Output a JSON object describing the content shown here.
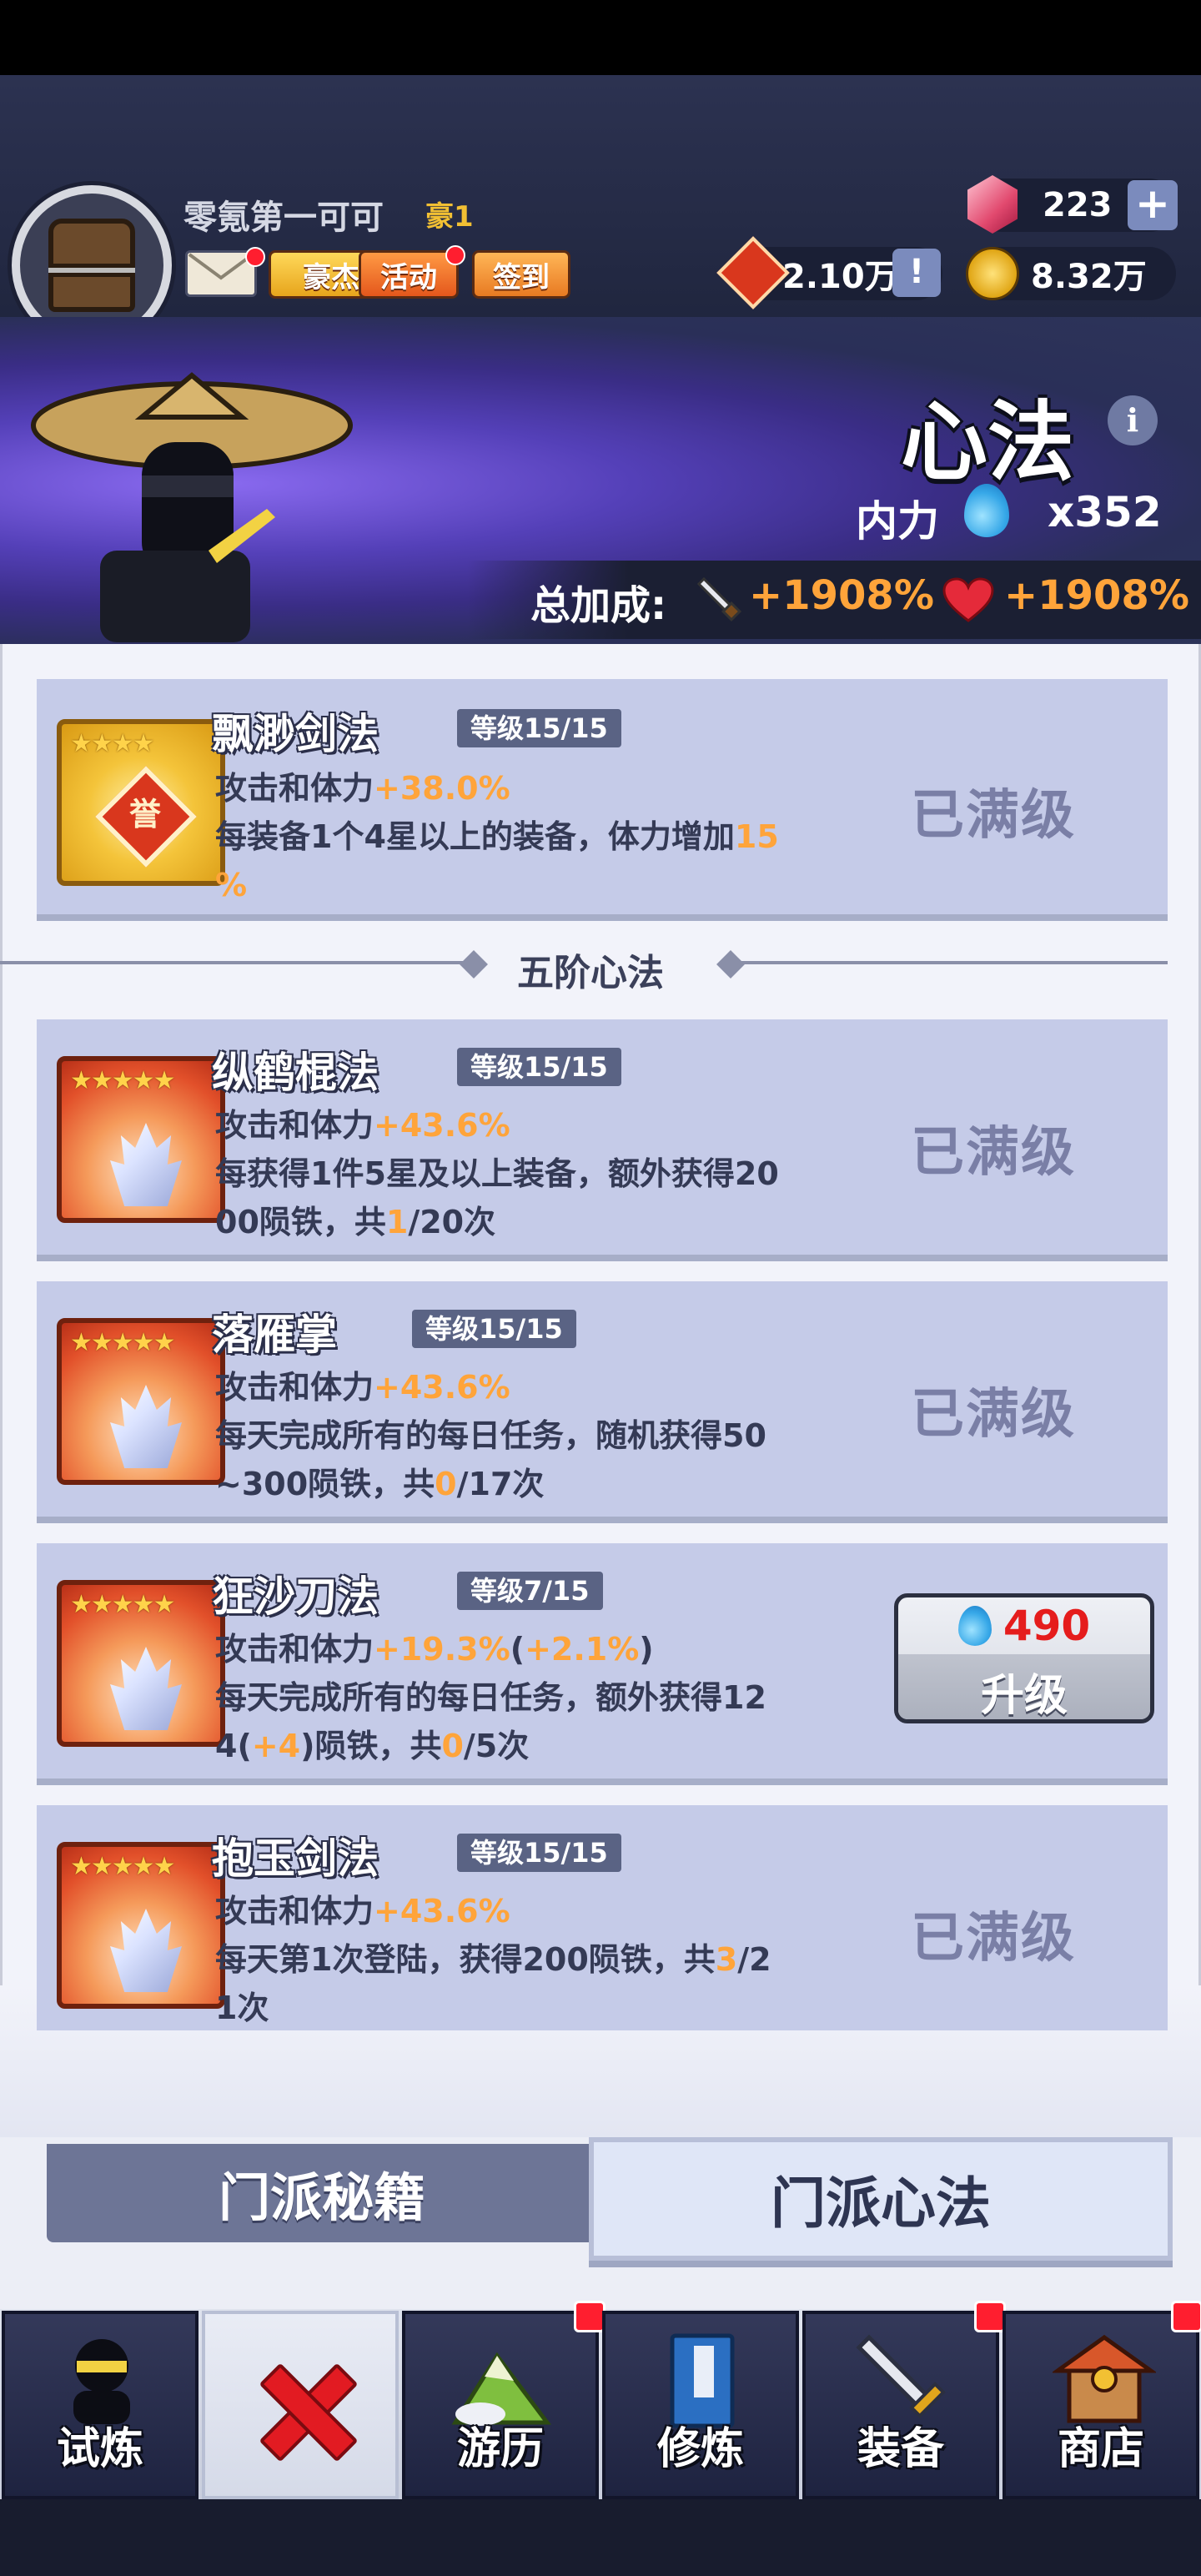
{
  "player": {
    "name": "零氪第一可可",
    "vip": "豪1",
    "gems": "223",
    "honor": "2.10万",
    "coins": "8.32万"
  },
  "header_buttons": {
    "hero": "豪杰",
    "activity": "活动",
    "signin": "签到"
  },
  "page": {
    "title": "心法",
    "neili_label": "内力",
    "neili_value": "x352",
    "bonus_label": "总加成:",
    "bonus_attack": "+1908%",
    "bonus_hp": "+1908%"
  },
  "section_title": "五阶心法",
  "skills": [
    {
      "name": "飘渺剑法",
      "level": "等级15/15",
      "line1_prefix": "攻击和体力",
      "line1_value": "+38.0%",
      "line2a": "每装备1个4星以上的装备，体力增加",
      "line2_value": "15",
      "line3_value": "%",
      "status": "已满级",
      "icon": "honor-seal-icon",
      "seal_text": "誉"
    },
    {
      "name": "纵鹤棍法",
      "level": "等级15/15",
      "line1_prefix": "攻击和体力",
      "line1_value": "+43.6%",
      "line2": "每获得1件5星及以上装备，额外获得20",
      "line3a": "00陨铁，共",
      "line3_value": "1",
      "line3b": "/20次",
      "status": "已满级"
    },
    {
      "name": "落雁掌",
      "level": "等级15/15",
      "line1_prefix": "攻击和体力",
      "line1_value": "+43.6%",
      "line2": "每天完成所有的每日任务，随机获得50",
      "line3a": "~300陨铁，共",
      "line3_value": "0",
      "line3b": "/17次",
      "status": "已满级"
    },
    {
      "name": "狂沙刀法",
      "level": "等级7/15",
      "line1_prefix": "攻击和体力",
      "line1_value": "+19.3%",
      "line1_open": "(",
      "line1_extra": "+2.1%",
      "line1_close": ")",
      "line2": "每天完成所有的每日任务，额外获得12",
      "line3a": "4(",
      "line3_extra": "+4",
      "line3b": ")陨铁，共",
      "line3_value": "0",
      "line3c": "/5次",
      "upgrade_cost": "490",
      "upgrade_label": "升级"
    },
    {
      "name": "抱玉剑法",
      "level": "等级15/15",
      "line1_prefix": "攻击和体力",
      "line1_value": "+43.6%",
      "line2a": "每天第1次登陆，获得200陨铁，共",
      "line2_value": "3",
      "line2b": "/2",
      "line3": "1次",
      "status": "已满级"
    }
  ],
  "stars": "★★★★★",
  "stars4": "★★★★",
  "bottom_tabs": {
    "secrets": "门派秘籍",
    "techniques": "门派心法"
  },
  "nav": [
    {
      "label": "试炼",
      "icon": "ninja-icon"
    },
    {
      "label": "",
      "icon": "crossed-swords-icon"
    },
    {
      "label": "游历",
      "icon": "mountain-icon"
    },
    {
      "label": "修炼",
      "icon": "scroll-book-icon"
    },
    {
      "label": "装备",
      "icon": "sword-icon"
    },
    {
      "label": "商店",
      "icon": "shop-icon"
    }
  ],
  "colors": {
    "accent_orange": "#ffa43a",
    "cost_red": "#e51c1c",
    "card_bg": "#c5cbe8"
  }
}
